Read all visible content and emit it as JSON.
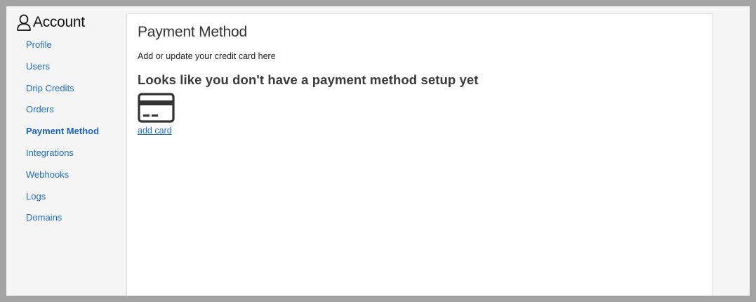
{
  "sidebar": {
    "icon": "user-icon",
    "title": "Account",
    "items": [
      {
        "label": "Profile",
        "active": false
      },
      {
        "label": "Users",
        "active": false
      },
      {
        "label": "Drip Credits",
        "active": false
      },
      {
        "label": "Orders",
        "active": false
      },
      {
        "label": "Payment Method",
        "active": true
      },
      {
        "label": "Integrations",
        "active": false
      },
      {
        "label": "Webhooks",
        "active": false
      },
      {
        "label": "Logs",
        "active": false
      },
      {
        "label": "Domains",
        "active": false
      }
    ]
  },
  "main": {
    "title": "Payment Method",
    "subtitle": "Add or update your credit card here",
    "empty_state": {
      "heading": "Looks like you don't have a payment method setup yet",
      "icon": "credit-card-icon",
      "link_label": "add card"
    }
  },
  "colors": {
    "link": "#1f6ed4",
    "background": "#f5f5f5",
    "panel": "#ffffff",
    "icon": "#333333"
  }
}
